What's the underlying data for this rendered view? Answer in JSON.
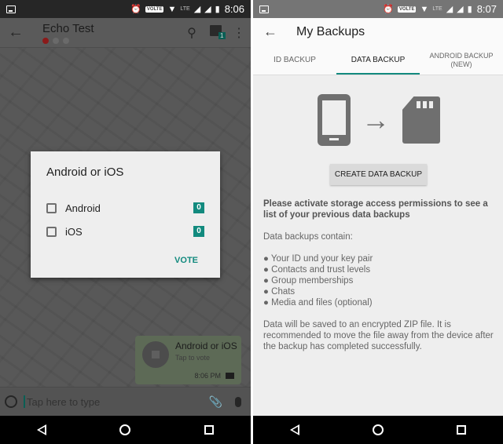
{
  "left": {
    "status": {
      "time": "8:06",
      "volte": "VOLTE",
      "lte": "LTE"
    },
    "appbar": {
      "title": "Echo Test",
      "back_icon": "←",
      "search_icon": "⚲",
      "badge": "1",
      "more_icon": "⋮"
    },
    "dialog": {
      "title": "Android or iOS",
      "options": [
        {
          "label": "Android",
          "count": "0"
        },
        {
          "label": "iOS",
          "count": "0"
        }
      ],
      "vote_label": "VOTE"
    },
    "bubble": {
      "title": "Android or iOS",
      "subtitle": "Tap to vote",
      "time": "8:06 PM"
    },
    "input": {
      "placeholder": "Tap here to type",
      "clip_icon": "📎"
    }
  },
  "right": {
    "status": {
      "time": "8:07",
      "volte": "VOLTE",
      "lte": "LTE"
    },
    "appbar": {
      "title": "My Backups",
      "back_icon": "←"
    },
    "tabs": [
      {
        "label": "ID BACKUP"
      },
      {
        "label": "DATA BACKUP"
      },
      {
        "label": "ANDROID BACKUP (NEW)"
      }
    ],
    "arrow_icon": "→",
    "create_button": "CREATE DATA BACKUP",
    "permission_text": "Please activate storage access permissions to see a list of your previous data backups",
    "contains_heading": "Data backups contain:",
    "contains_items": [
      "● Your ID und your key pair",
      "● Contacts and trust levels",
      "● Group memberships",
      "● Chats",
      "● Media and files (optional)"
    ],
    "footer_text": "Data will be saved to an encrypted ZIP file. It is recommended to move the file away from the device after the backup has completed successfully."
  },
  "colors": {
    "accent": "#128a7e",
    "dim_overlay": "#585858"
  }
}
